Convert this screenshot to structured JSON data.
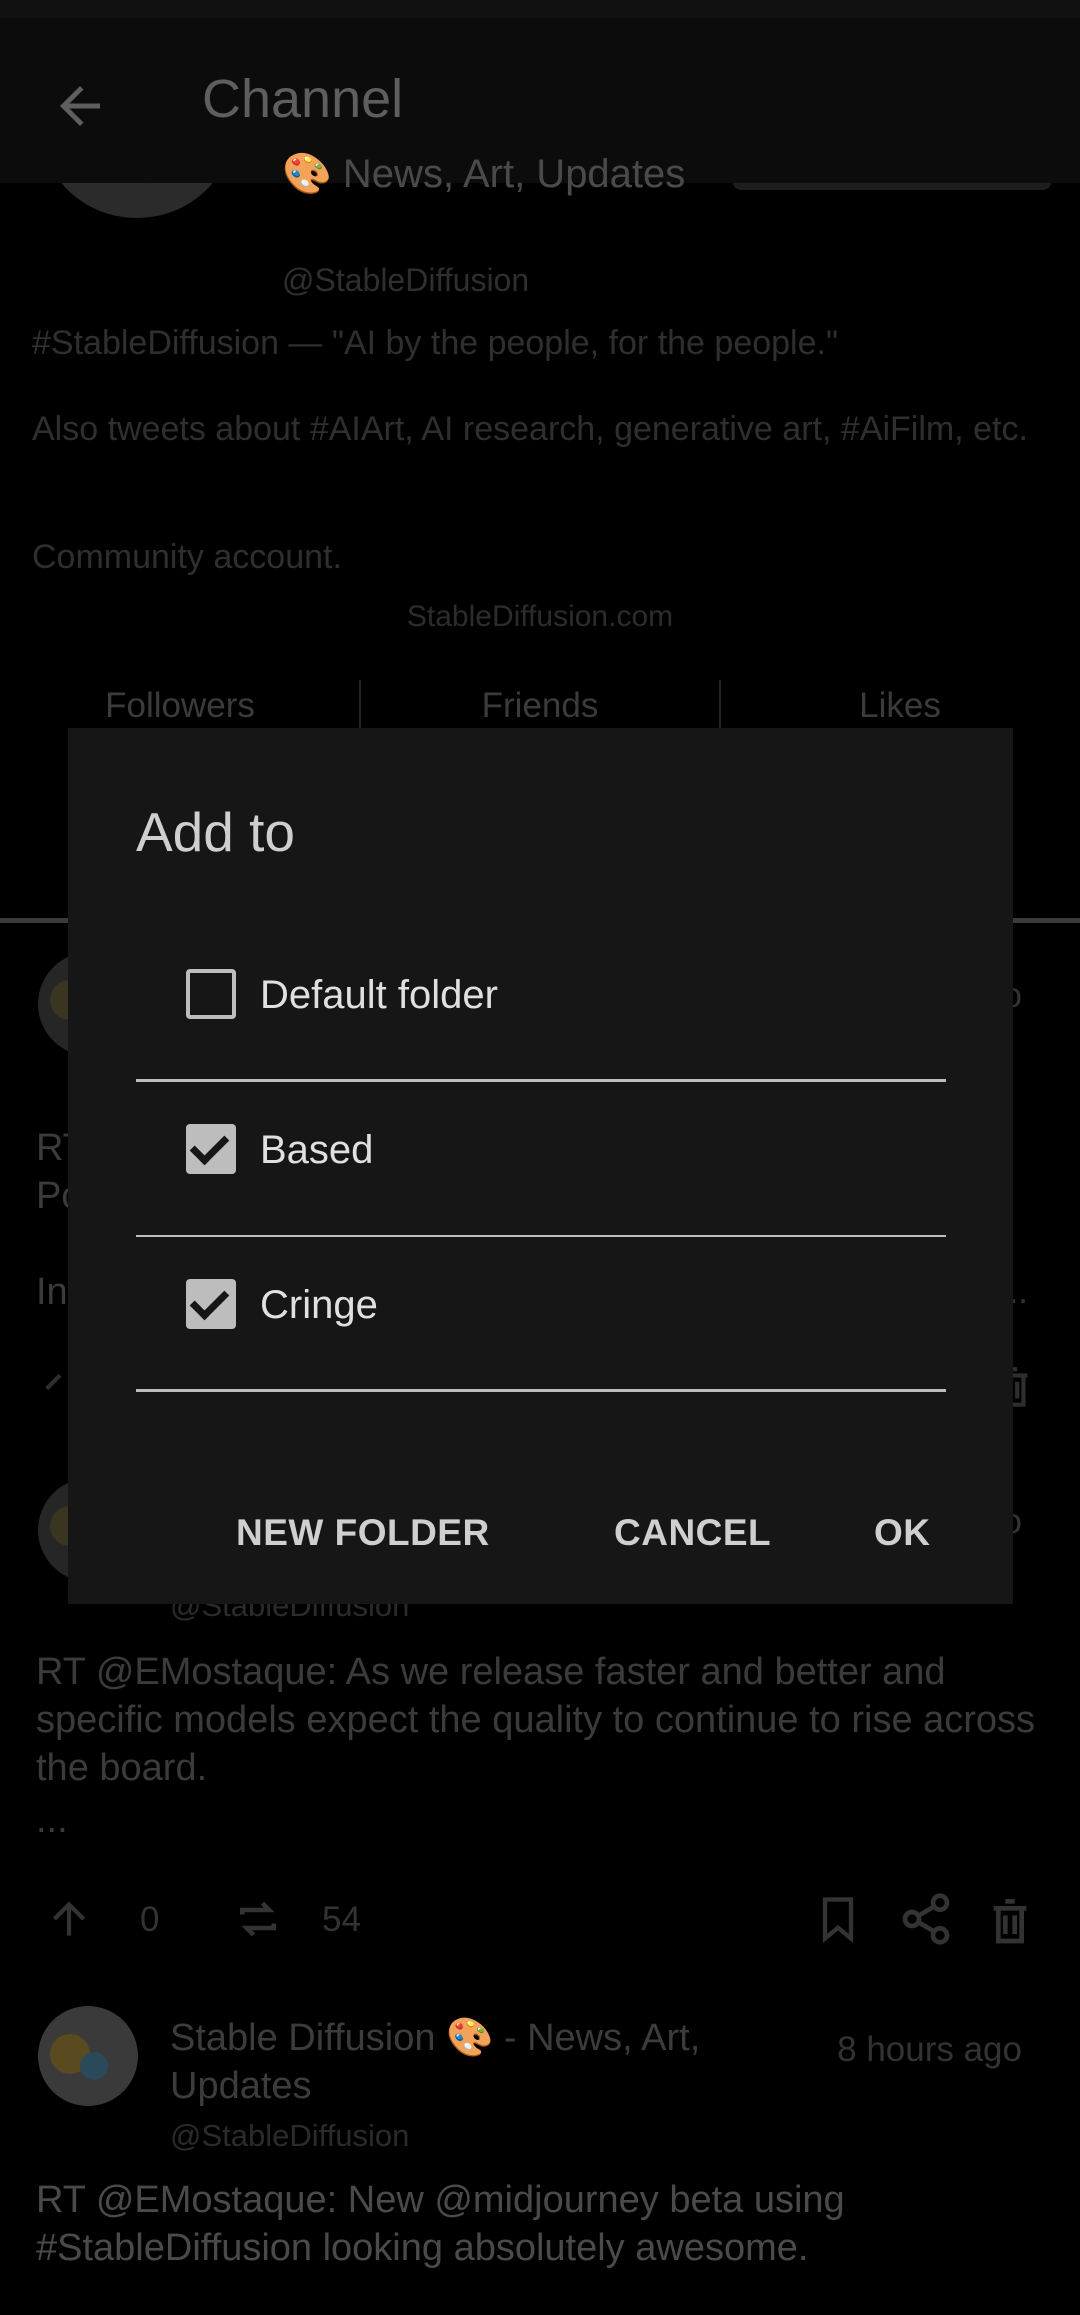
{
  "appbar": {
    "title": "Channel"
  },
  "profile": {
    "name": "News, Art, Updates",
    "handle": "@StableDiffusion",
    "bio_lines": [
      "#StableDiffusion — \"AI by the people, for the people.\"",
      "Also tweets about #AIArt, AI research, generative art, #AiFilm, etc.",
      "Community account."
    ],
    "website": "StableDiffusion.com"
  },
  "tabs": [
    "Followers",
    "Friends",
    "Likes"
  ],
  "posts": [
    {
      "text_partial_1": "RT",
      "text_partial_2": "Po",
      "text_partial_3": "In",
      "time_partial": "o",
      "ellipsis": "..."
    },
    {
      "handle": "@StableDiffusion",
      "text": "RT @EMostaque: As we release faster and better and specific models expect the quality to continue to rise across the board.",
      "more": "...",
      "upvotes": "0",
      "retweets": "54",
      "time_partial": "o"
    },
    {
      "name": "Stable Diffusion 🎨 - News, Art, Updates",
      "handle": "@StableDiffusion",
      "time": "8 hours ago",
      "text": "RT @EMostaque: New @midjourney beta using #StableDiffusion looking absolutely awesome."
    }
  ],
  "dialog": {
    "title": "Add to",
    "options": [
      {
        "label": "Default folder",
        "checked": false
      },
      {
        "label": "Based",
        "checked": true
      },
      {
        "label": "Cringe",
        "checked": true
      }
    ],
    "buttons": {
      "new_folder": "NEW FOLDER",
      "cancel": "CANCEL",
      "ok": "OK"
    }
  }
}
